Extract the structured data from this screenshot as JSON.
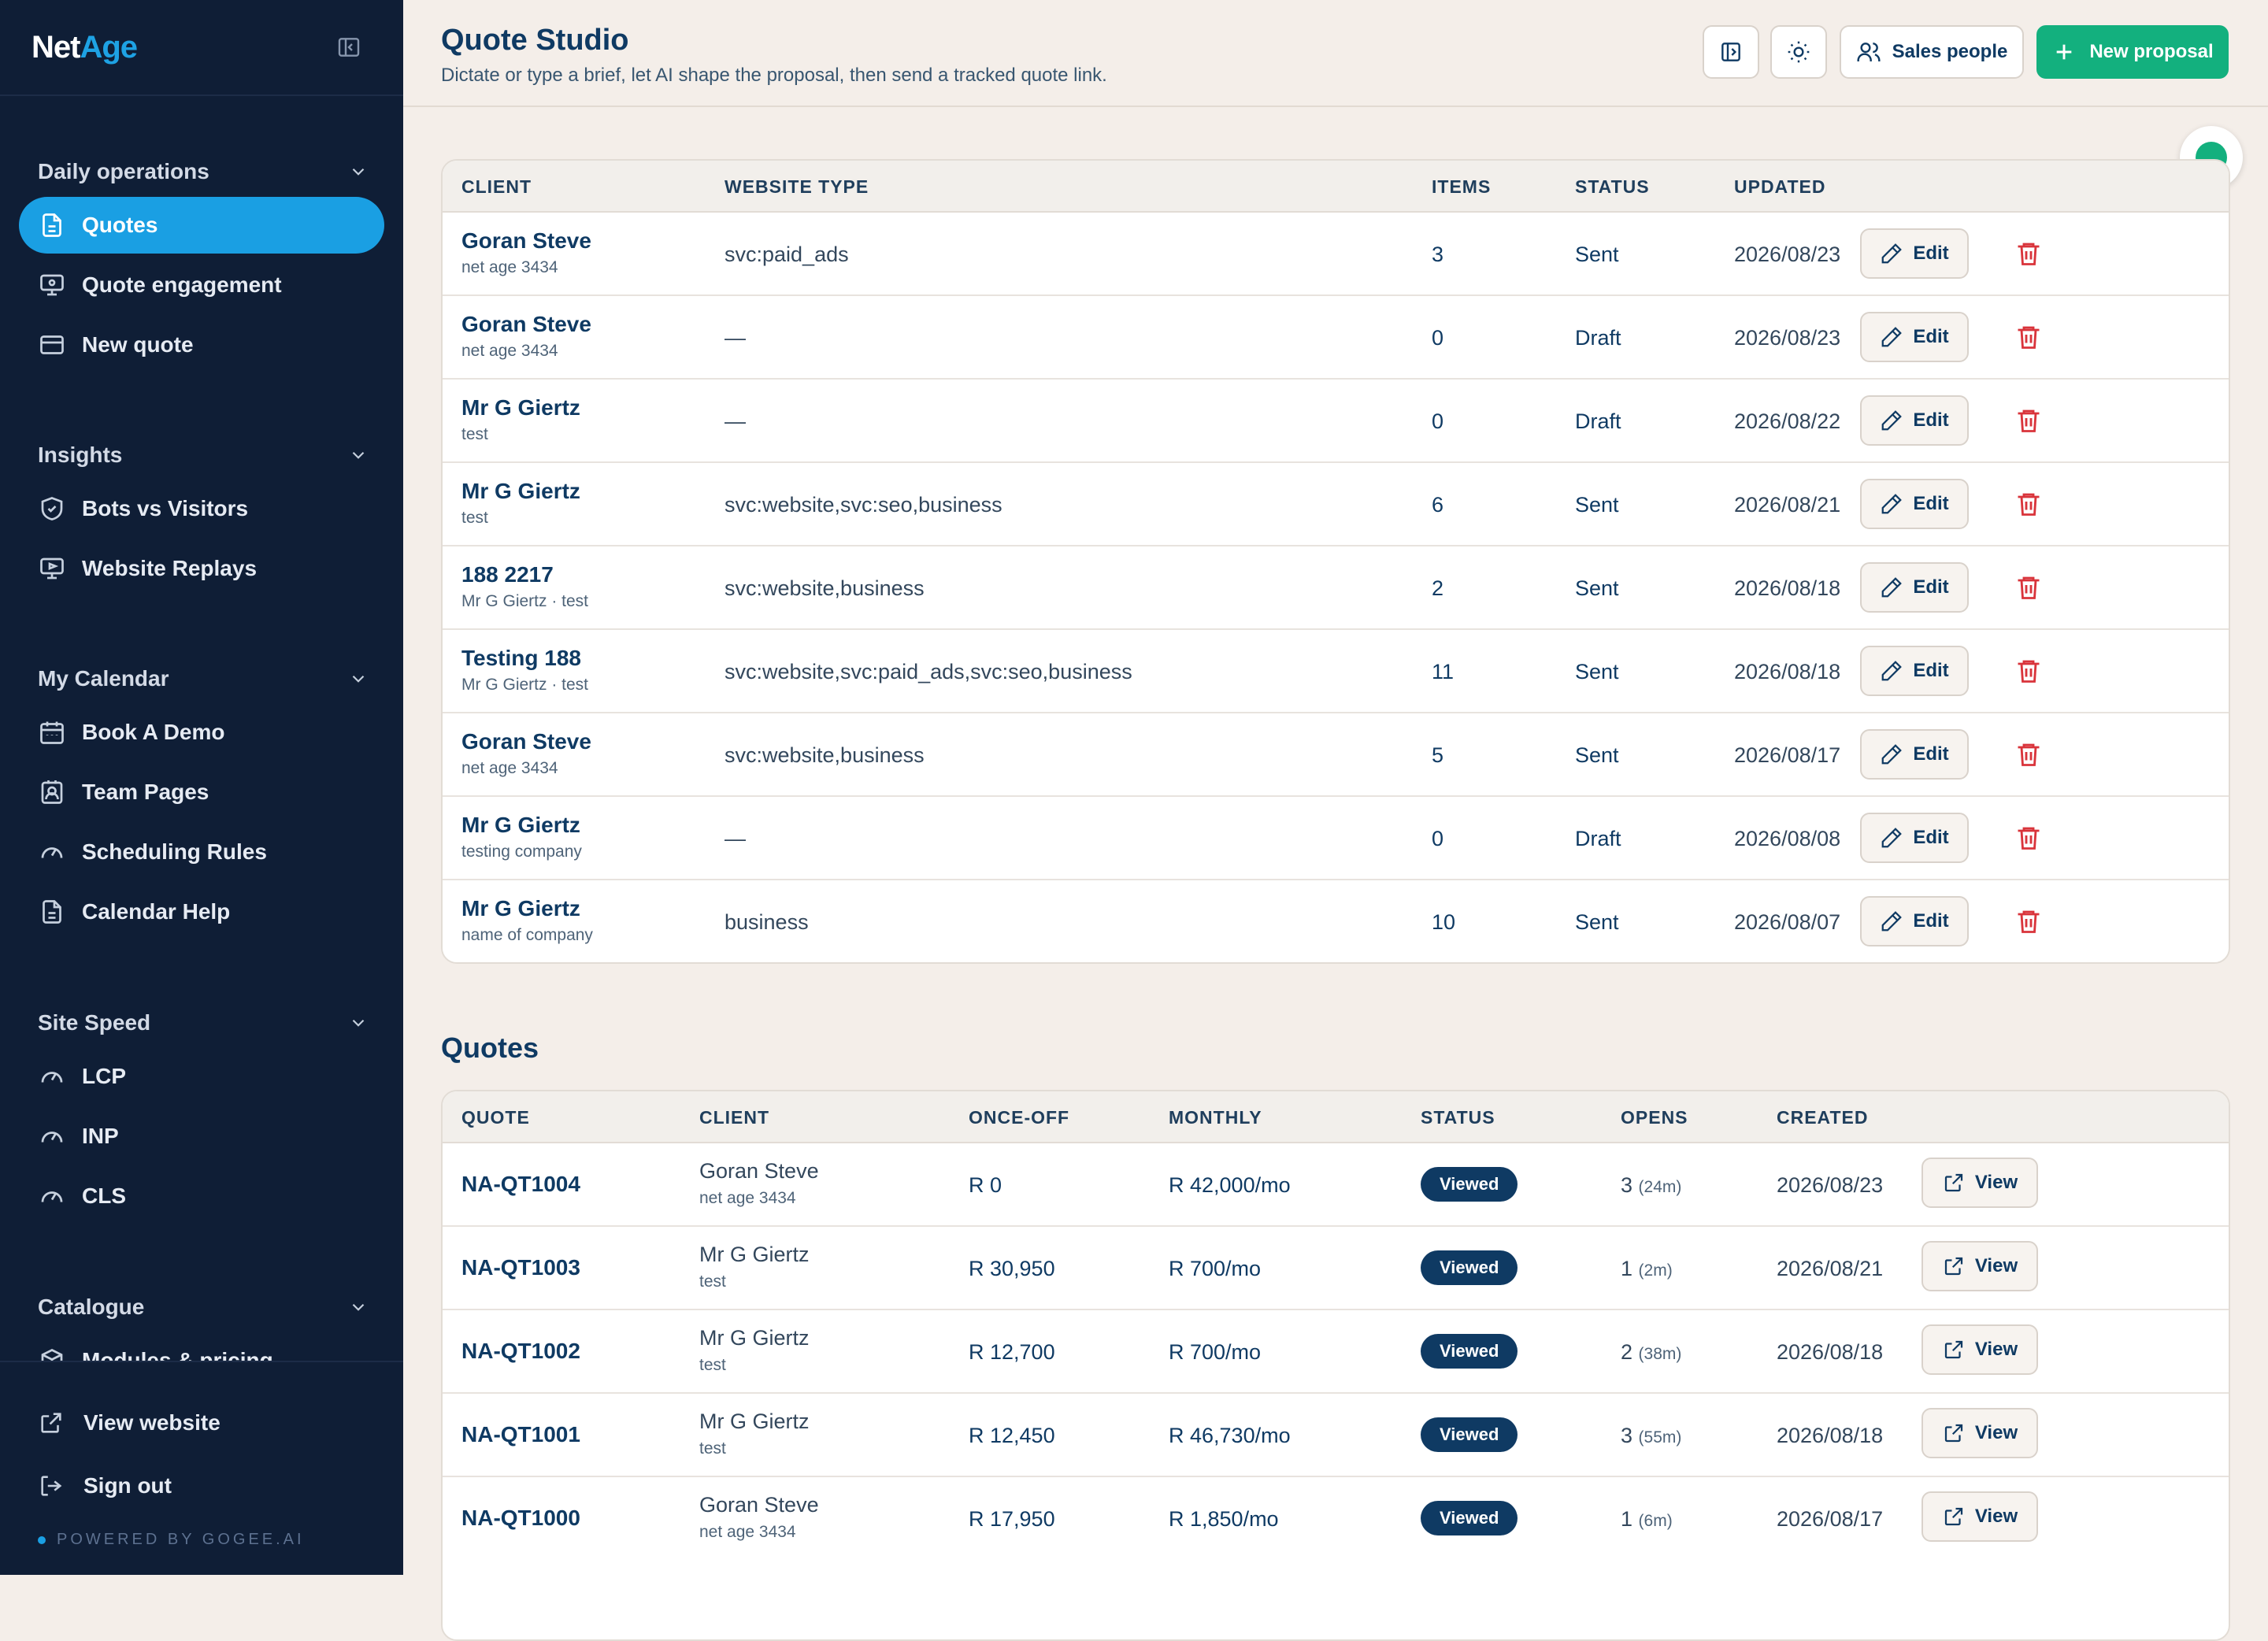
{
  "sidebar": {
    "brand_a": "Net",
    "brand_b": "Age",
    "groups": [
      {
        "title": "Daily operations",
        "items": [
          {
            "label": "Quotes",
            "icon": "file-text-icon",
            "active": true
          },
          {
            "label": "Quote engagement",
            "icon": "monitor-icon"
          },
          {
            "label": "New quote",
            "icon": "credit-card-icon"
          }
        ]
      },
      {
        "title": "Insights",
        "items": [
          {
            "label": "Bots vs Visitors",
            "icon": "shield-check-icon"
          },
          {
            "label": "Website Replays",
            "icon": "monitor-play-icon"
          }
        ]
      },
      {
        "title": "My Calendar",
        "items": [
          {
            "label": "Book A Demo",
            "icon": "calendar-icon"
          },
          {
            "label": "Team Pages",
            "icon": "contact-icon"
          },
          {
            "label": "Scheduling Rules",
            "icon": "gauge-icon"
          },
          {
            "label": "Calendar Help",
            "icon": "file-text-icon"
          }
        ]
      },
      {
        "title": "Site Speed",
        "items": [
          {
            "label": "LCP",
            "icon": "gauge-icon"
          },
          {
            "label": "INP",
            "icon": "gauge-icon"
          },
          {
            "label": "CLS",
            "icon": "gauge-icon"
          }
        ]
      },
      {
        "title": "Catalogue",
        "items": [
          {
            "label": "Modules & pricing",
            "icon": "package-icon"
          }
        ]
      }
    ],
    "footer": {
      "view_website": "View website",
      "sign_out": "Sign out",
      "powered": "POWERED BY GOGEE.AI"
    }
  },
  "header": {
    "title": "Quote Studio",
    "subtitle": "Dictate or type a brief, let AI shape the proposal, then send a tracked quote link.",
    "sales_people": "Sales people",
    "new_proposal": "New proposal"
  },
  "proposals": {
    "columns": [
      "CLIENT",
      "WEBSITE TYPE",
      "ITEMS",
      "STATUS",
      "UPDATED"
    ],
    "edit_label": "Edit",
    "rows": [
      {
        "client": "Goran Steve",
        "company": "net age 3434",
        "type": "svc:paid_ads",
        "items": "3",
        "status": "Sent",
        "updated": "2026/08/23"
      },
      {
        "client": "Goran Steve",
        "company": "net age 3434",
        "type": "—",
        "items": "0",
        "status": "Draft",
        "updated": "2026/08/23"
      },
      {
        "client": "Mr G Giertz",
        "company": "test",
        "type": "—",
        "items": "0",
        "status": "Draft",
        "updated": "2026/08/22"
      },
      {
        "client": "Mr G Giertz",
        "company": "test",
        "type": "svc:website,svc:seo,business",
        "items": "6",
        "status": "Sent",
        "updated": "2026/08/21"
      },
      {
        "client": "188 2217",
        "company": "Mr G Giertz · test",
        "type": "svc:website,business",
        "items": "2",
        "status": "Sent",
        "updated": "2026/08/18"
      },
      {
        "client": "Testing 188",
        "company": "Mr G Giertz · test",
        "type": "svc:website,svc:paid_ads,svc:seo,business",
        "items": "11",
        "status": "Sent",
        "updated": "2026/08/18"
      },
      {
        "client": "Goran Steve",
        "company": "net age 3434",
        "type": "svc:website,business",
        "items": "5",
        "status": "Sent",
        "updated": "2026/08/17"
      },
      {
        "client": "Mr G Giertz",
        "company": "testing company",
        "type": "—",
        "items": "0",
        "status": "Draft",
        "updated": "2026/08/08"
      },
      {
        "client": "Mr G Giertz",
        "company": "name of company",
        "type": "business",
        "items": "10",
        "status": "Sent",
        "updated": "2026/08/07"
      }
    ]
  },
  "quotes": {
    "title": "Quotes",
    "columns": [
      "QUOTE",
      "CLIENT",
      "ONCE-OFF",
      "MONTHLY",
      "STATUS",
      "OPENS",
      "CREATED"
    ],
    "view_label": "View",
    "rows": [
      {
        "id": "NA-QT1004",
        "client": "Goran Steve",
        "company": "net age 3434",
        "once": "R 0",
        "monthly": "R 42,000/mo",
        "status": "Viewed",
        "opens": "3",
        "opens_time": "(24m)",
        "created": "2026/08/23"
      },
      {
        "id": "NA-QT1003",
        "client": "Mr G Giertz",
        "company": "test",
        "once": "R 30,950",
        "monthly": "R 700/mo",
        "status": "Viewed",
        "opens": "1",
        "opens_time": "(2m)",
        "created": "2026/08/21"
      },
      {
        "id": "NA-QT1002",
        "client": "Mr G Giertz",
        "company": "test",
        "once": "R 12,700",
        "monthly": "R 700/mo",
        "status": "Viewed",
        "opens": "2",
        "opens_time": "(38m)",
        "created": "2026/08/18"
      },
      {
        "id": "NA-QT1001",
        "client": "Mr G Giertz",
        "company": "test",
        "once": "R 12,450",
        "monthly": "R 46,730/mo",
        "status": "Viewed",
        "opens": "3",
        "opens_time": "(55m)",
        "created": "2026/08/18"
      },
      {
        "id": "NA-QT1000",
        "client": "Goran Steve",
        "company": "net age 3434",
        "once": "R 17,950",
        "monthly": "R 1,850/mo",
        "status": "Viewed",
        "opens": "1",
        "opens_time": "(6m)",
        "created": "2026/08/17"
      }
    ]
  },
  "colors": {
    "sidebar_bg": "#0f1e36",
    "accent": "#1a9fe3",
    "primary": "#13b07e",
    "danger": "#d9343b",
    "navy": "#0f3a63"
  }
}
